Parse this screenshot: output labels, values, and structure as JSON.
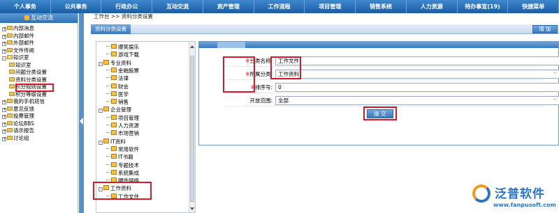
{
  "topnav": [
    "个人事务",
    "公共事务",
    "行政办公",
    "互动交流",
    "资产管理",
    "工作流程",
    "项目管理",
    "销售系统",
    "人力资源",
    "待办事宜(19)",
    "快捷菜单"
  ],
  "sidebar": {
    "header": "互动交流",
    "items": [
      {
        "label": "内部消息",
        "level": 0,
        "expander": "+"
      },
      {
        "label": "内部邮件",
        "level": 0,
        "expander": "+"
      },
      {
        "label": "外部邮件",
        "level": 0,
        "expander": "+"
      },
      {
        "label": "文件传阅",
        "level": 0,
        "expander": "+"
      },
      {
        "label": "知识室",
        "level": 0,
        "expander": "-"
      },
      {
        "label": "知识室",
        "level": 1,
        "expander": ""
      },
      {
        "label": "问题分类设置",
        "level": 1,
        "expander": ""
      },
      {
        "label": "资料分类设置",
        "level": 1,
        "expander": ""
      },
      {
        "label": "积分规则设置",
        "level": 1,
        "expander": ""
      },
      {
        "label": "积分等级设置",
        "level": 1,
        "expander": ""
      },
      {
        "label": "我的手机班信",
        "level": 0,
        "expander": "+"
      },
      {
        "label": "意见反馈",
        "level": 0,
        "expander": "+"
      },
      {
        "label": "投票管理",
        "level": 0,
        "expander": "+"
      },
      {
        "label": "论坛BBS",
        "level": 0,
        "expander": "+"
      },
      {
        "label": "请示报告",
        "level": 0,
        "expander": "+"
      },
      {
        "label": "讨论组",
        "level": 0,
        "expander": "+"
      }
    ]
  },
  "breadcrumb": "工作台 >> 资料分类设置",
  "tab_label": "资料分类设置",
  "add_label": "增 加",
  "tree": [
    {
      "label": "爆笑娱乐",
      "level": 2
    },
    {
      "label": "游戏下载",
      "level": 2
    },
    {
      "label": "专业资料",
      "level": 1
    },
    {
      "label": "金融股票",
      "level": 2
    },
    {
      "label": "法律",
      "level": 2
    },
    {
      "label": "财会",
      "level": 2
    },
    {
      "label": "医学",
      "level": 2
    },
    {
      "label": "销售",
      "level": 2
    },
    {
      "label": "企业管理",
      "level": 1
    },
    {
      "label": "项目管理",
      "level": 2
    },
    {
      "label": "人力资源",
      "level": 2
    },
    {
      "label": "市场营销",
      "level": 2
    },
    {
      "label": "IT资料",
      "level": 1
    },
    {
      "label": "常用软件",
      "level": 2
    },
    {
      "label": "IT书籍",
      "level": 2
    },
    {
      "label": "专题技术",
      "level": 2
    },
    {
      "label": "系统集成",
      "level": 2
    },
    {
      "label": "硬件网络",
      "level": 2
    },
    {
      "label": "工作资料",
      "level": 1
    },
    {
      "label": "工作文件",
      "level": 2
    }
  ],
  "form": {
    "req_mark": "※",
    "category_name_label": "分类名称:",
    "category_name_value": "工作文件",
    "parent_label": "所属分类:",
    "parent_value": "工作资料",
    "order_label": "排序号:",
    "order_value": "0",
    "scope_label": "开放范围:",
    "scope_value": "全部",
    "submit_label": "提 交"
  },
  "watermark": {
    "name": "泛普软件",
    "url": "www.fanpusoft.com"
  }
}
